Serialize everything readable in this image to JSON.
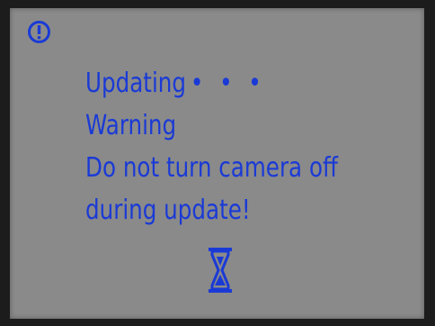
{
  "colors": {
    "text": "#1a3ad6",
    "screen_background": "#8a8a8a",
    "bezel": "#1c1c1c"
  },
  "icons": {
    "alert": "exclamation-circle-icon",
    "progress": "hourglass-icon"
  },
  "dialog": {
    "icon_glyph": "!",
    "status_label": "Updating",
    "status_dots": "• • •",
    "warning_title": "Warning",
    "message_line1": "Do not turn camera off",
    "message_line2": "during update!"
  }
}
